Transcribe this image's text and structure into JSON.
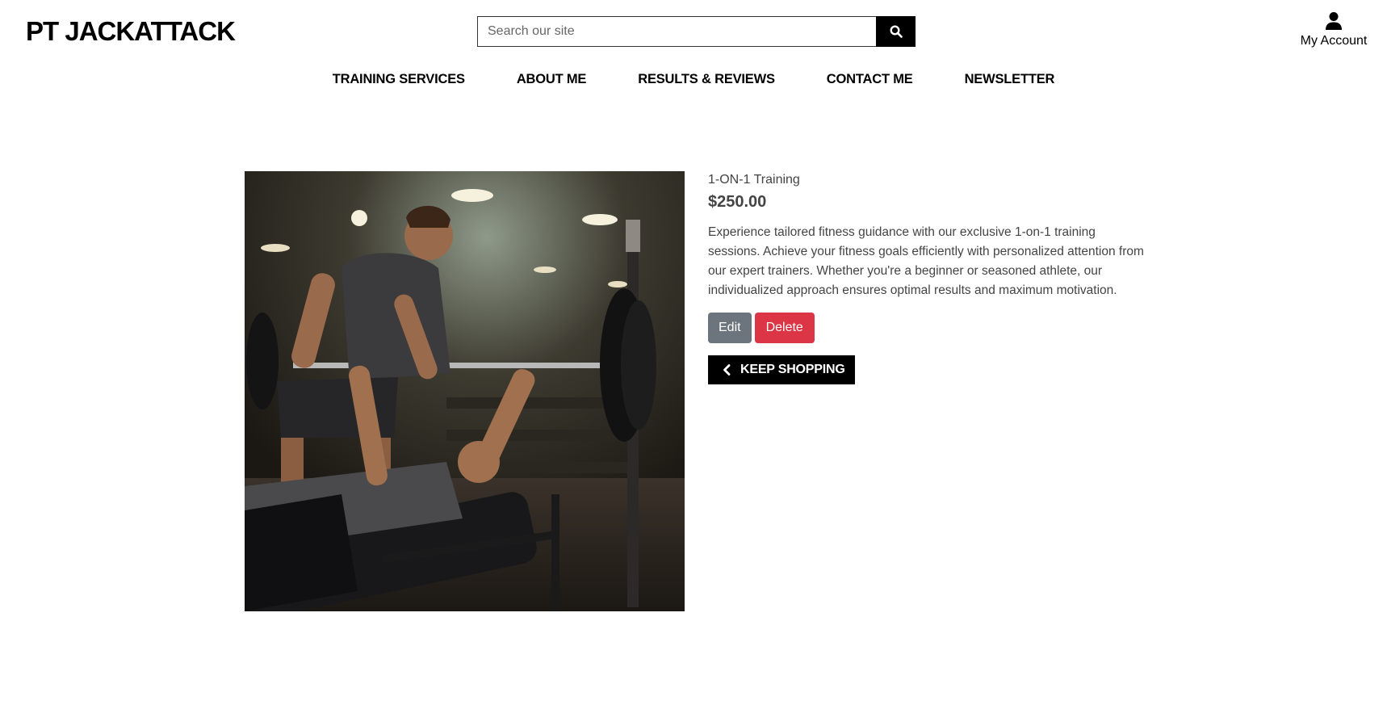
{
  "header": {
    "brand": "PT JACKATTACK",
    "search": {
      "placeholder": "Search our site",
      "value": ""
    },
    "account_label": "My Account"
  },
  "nav": {
    "items": [
      {
        "label": "TRAINING SERVICES"
      },
      {
        "label": "ABOUT ME"
      },
      {
        "label": "RESULTS & REVIEWS"
      },
      {
        "label": "CONTACT ME"
      },
      {
        "label": "NEWSLETTER"
      }
    ]
  },
  "product": {
    "name": "1-ON-1 Training",
    "price": "$250.00",
    "description": "Experience tailored fitness guidance with our exclusive 1-on-1 training sessions. Achieve your fitness goals efficiently with personalized attention from our expert trainers. Whether you're a beginner or seasoned athlete, our individualized approach ensures optimal results and maximum motivation.",
    "image_alt": "Trainer spotting a client on a bench press in a gym"
  },
  "actions": {
    "edit_label": "Edit",
    "delete_label": "Delete",
    "keep_shopping_label": "KEEP SHOPPING"
  },
  "icons": {
    "search": "search-icon",
    "account": "user-icon",
    "back": "chevron-left-icon"
  },
  "colors": {
    "edit": "#6c757d",
    "delete": "#dc3545",
    "primary": "#000000",
    "text": "#444444"
  }
}
